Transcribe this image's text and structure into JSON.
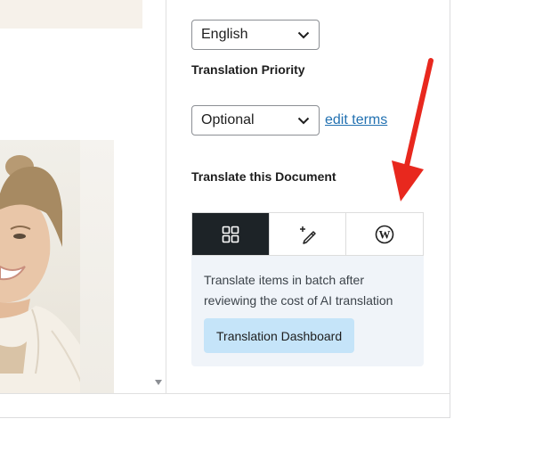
{
  "sidebar": {
    "language_select": {
      "value": "English"
    },
    "priority_label": "Translation Priority",
    "priority_select": {
      "value": "Optional"
    },
    "edit_terms_link": "edit terms",
    "translate_heading": "Translate this Document",
    "tabs": [
      {
        "icon": "grid-icon",
        "active": true
      },
      {
        "icon": "magic-wand-pencil-icon",
        "active": false
      },
      {
        "icon": "wordpress-icon",
        "active": false
      }
    ],
    "panel": {
      "description": "Translate items in batch after reviewing the cost of AI translation",
      "dashboard_button": "Translation Dashboard"
    }
  },
  "colors": {
    "active_tab": "#1d2327",
    "panel_bg": "#f0f4f9",
    "button_bg": "#c5e4f9",
    "link": "#2271b1",
    "arrow": "#e8281e"
  }
}
